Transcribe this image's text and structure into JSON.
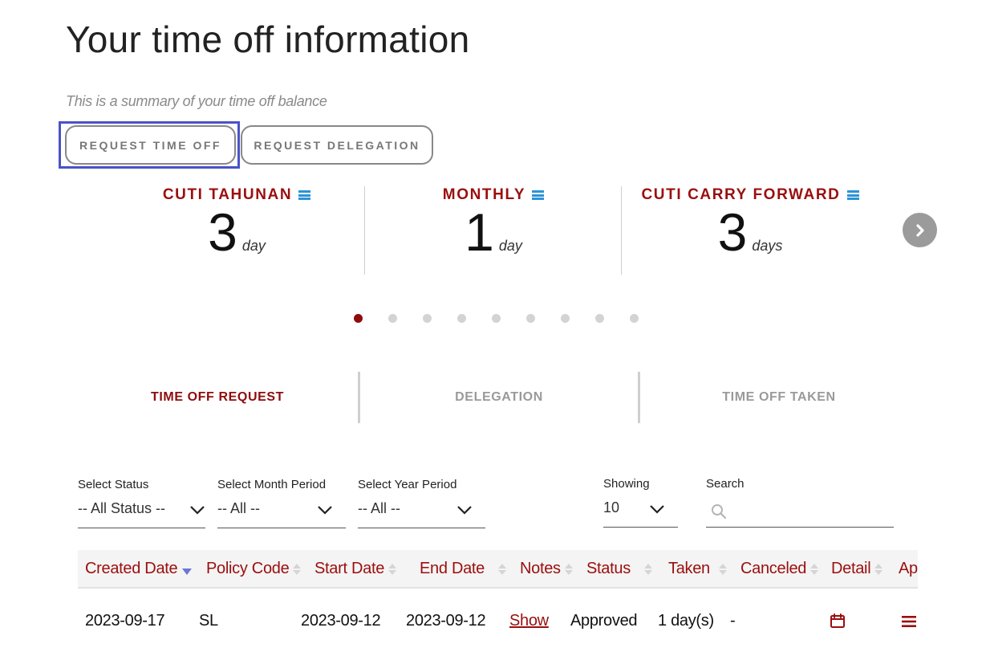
{
  "page": {
    "title": "Your time off information",
    "subtitle": "This is a summary of your time off balance"
  },
  "actions": {
    "request_time_off": "REQUEST TIME OFF",
    "request_delegation": "REQUEST DELEGATION"
  },
  "balances": [
    {
      "name": "CUTI TAHUNAN",
      "value": "3",
      "unit": "day"
    },
    {
      "name": "MONTHLY",
      "value": "1",
      "unit": "day"
    },
    {
      "name": "CUTI CARRY FORWARD",
      "value": "3",
      "unit": "days"
    }
  ],
  "carousel": {
    "total_pages": 9,
    "active_page": 1
  },
  "tabs": [
    {
      "label": "TIME OFF REQUEST",
      "active": true
    },
    {
      "label": "DELEGATION",
      "active": false
    },
    {
      "label": "TIME OFF TAKEN",
      "active": false
    }
  ],
  "filters": {
    "status": {
      "label": "Select Status",
      "value": "-- All Status --"
    },
    "month": {
      "label": "Select Month Period",
      "value": "-- All --"
    },
    "year": {
      "label": "Select Year Period",
      "value": "-- All --"
    },
    "showing": {
      "label": "Showing",
      "value": "10"
    },
    "search": {
      "label": "Search",
      "placeholder": ""
    }
  },
  "table": {
    "columns": [
      "Created Date",
      "Policy Code",
      "Start Date",
      "End Date",
      "Notes",
      "Status",
      "Taken",
      "Canceled",
      "Detail",
      "Ap"
    ],
    "rows": [
      {
        "created_date": "2023-09-17",
        "policy_code": "SL",
        "start_date": "2023-09-12",
        "end_date": "2023-09-12",
        "notes": "Show",
        "status": "Approved",
        "taken": "1 day(s)",
        "canceled": "-",
        "detail_icon": "calendar-icon",
        "approval_icon": "menu-icon"
      }
    ]
  },
  "colors": {
    "accent": "#9b0e0e",
    "focus": "#4a52c8",
    "menu_icon": "#2b93d6",
    "next_button": "#9b9b9b"
  }
}
